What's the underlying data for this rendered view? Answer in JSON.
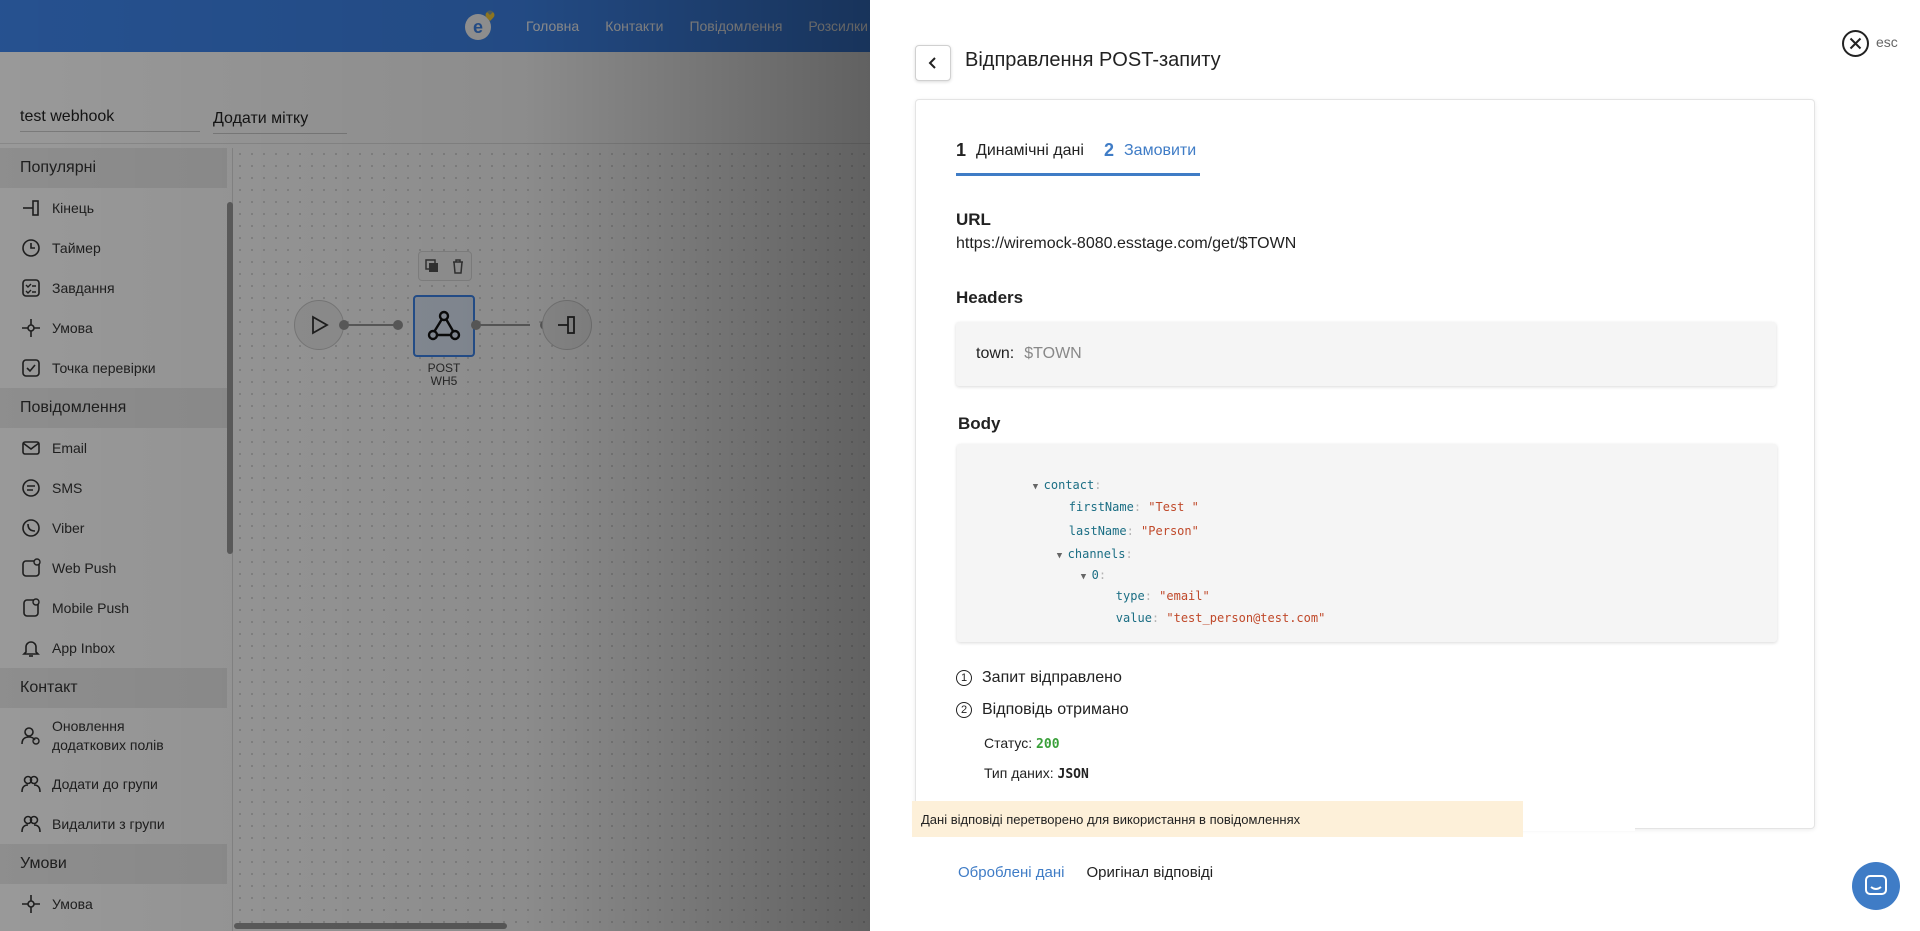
{
  "nav": {
    "items": [
      "Головна",
      "Контакти",
      "Повідомлення",
      "Розсилки"
    ]
  },
  "editor": {
    "name_value": "test webhook",
    "tag_placeholder": "Додати мітку"
  },
  "sidebar": {
    "sections": [
      {
        "title": "Популярні",
        "items": [
          {
            "label": "Кінець",
            "icon": "end-icon"
          },
          {
            "label": "Таймер",
            "icon": "timer-icon"
          },
          {
            "label": "Завдання",
            "icon": "task-icon"
          },
          {
            "label": "Умова",
            "icon": "condition-icon"
          },
          {
            "label": "Точка перевірки",
            "icon": "checkpoint-icon"
          }
        ]
      },
      {
        "title": "Повідомлення",
        "items": [
          {
            "label": "Email",
            "icon": "email-icon"
          },
          {
            "label": "SMS",
            "icon": "sms-icon"
          },
          {
            "label": "Viber",
            "icon": "viber-icon"
          },
          {
            "label": "Web Push",
            "icon": "web-push-icon"
          },
          {
            "label": "Mobile Push",
            "icon": "mobile-push-icon"
          },
          {
            "label": "App Inbox",
            "icon": "app-inbox-icon"
          }
        ]
      },
      {
        "title": "Контакт",
        "items": [
          {
            "label": "Оновлення додаткових полів",
            "icon": "update-fields-icon"
          },
          {
            "label": "Додати до групи",
            "icon": "add-to-group-icon"
          },
          {
            "label": "Видалити з групи",
            "icon": "remove-from-group-icon"
          }
        ]
      },
      {
        "title": "Умови",
        "items": [
          {
            "label": "Умова",
            "icon": "condition-icon"
          }
        ]
      }
    ]
  },
  "flow": {
    "node_label_line1": "POST",
    "node_label_line2": "WH5"
  },
  "panel": {
    "title": "Відправлення POST-запиту",
    "esc": "esc",
    "tabs": [
      {
        "num": "1",
        "label": "Динамічні дані"
      },
      {
        "num": "2",
        "label": "Замовити"
      }
    ],
    "url_title": "URL",
    "url_value": "https://wiremock-8080.esstage.com/get/$TOWN",
    "headers_title": "Headers",
    "header_key": "town:",
    "header_value": "$TOWN",
    "body_title": "Body",
    "body": {
      "contact_key": "contact",
      "firstName_key": "firstName",
      "firstName_val": "\"Test \"",
      "lastName_key": "lastName",
      "lastName_val": "\"Person\"",
      "channels_key": "channels",
      "index_key": "0",
      "type_key": "type",
      "type_val": "\"email\"",
      "value_key": "value",
      "value_val": "\"test_person@test.com\""
    },
    "status1_num": "1",
    "status1": "Запит відправлено",
    "status2_num": "2",
    "status2": "Відповідь отримано",
    "status_label": "Статус:",
    "status_code": "200",
    "datatype_label": "Тип даних:",
    "datatype_value": "JSON",
    "notice": "Дані відповіді перетворено для використання в повідомленнях",
    "subtab_processed": "Оброблені дані",
    "subtab_original": "Оригінал відповіді"
  },
  "colors": {
    "brand_blue": "#3f87ef",
    "accent": "#3f7cc6",
    "success": "#3aa03a",
    "notice_bg": "#fdf0d9"
  }
}
